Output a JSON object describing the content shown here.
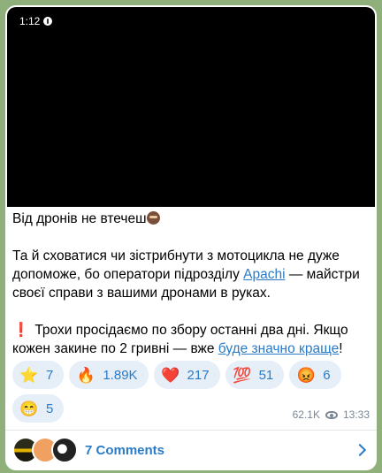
{
  "video": {
    "duration": "1:12"
  },
  "post": {
    "line1": "Від дронів не втечеш",
    "para2_before": "Та й сховатися чи зістрибнути з мотоцикла не дуже допоможе, бо оператори підрозділу ",
    "para2_link": "Apachi",
    "para2_after": " — майстри своєї справи з вашими дронами в руках.",
    "para3_excl": "❗",
    "para3_before": "Трохи просідаємо по збору останні два дні. Якщо кожен закине по 2 гривні — вже ",
    "para3_link": "буде значно краще",
    "para3_after": "!"
  },
  "reactions": [
    {
      "icon": "star-icon",
      "glyph": "⭐",
      "count": "7"
    },
    {
      "icon": "fire-icon",
      "glyph": "🔥",
      "count": "1.89K"
    },
    {
      "icon": "heart-icon",
      "glyph": "❤️",
      "count": "217"
    },
    {
      "icon": "hundred-icon",
      "glyph": "💯",
      "count": "51"
    },
    {
      "icon": "angry-face-icon",
      "glyph": "😡",
      "count": "6"
    },
    {
      "icon": "grin-face-icon",
      "glyph": "😁",
      "count": "5"
    }
  ],
  "meta": {
    "views": "62.1K",
    "time": "13:33"
  },
  "comments": {
    "label": "7 Comments"
  },
  "colors": {
    "accent": "#2a7bc7",
    "chip_bg": "#e6eef7",
    "background": "#8fb07a"
  }
}
